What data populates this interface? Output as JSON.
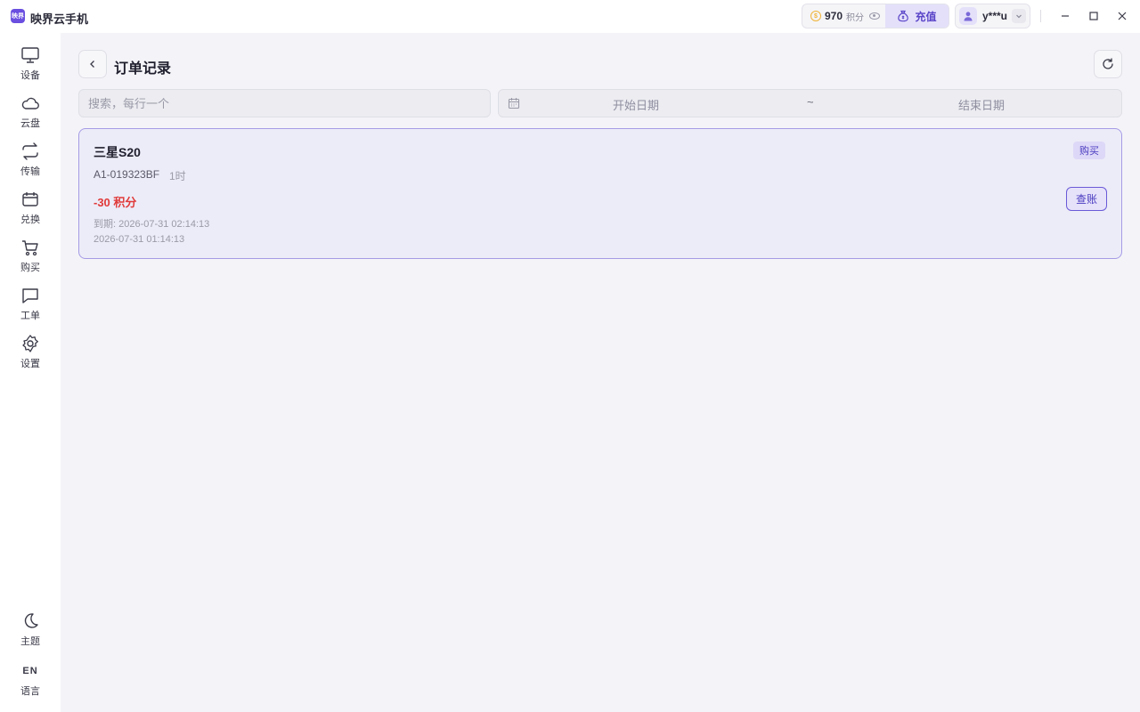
{
  "app": {
    "logo_text": "映界",
    "title": "映界云手机"
  },
  "header": {
    "points_value": "970",
    "points_unit": "积分",
    "recharge_label": "充值",
    "username": "y***u"
  },
  "sidebar": {
    "items": [
      {
        "label": "设备",
        "icon": "monitor-icon"
      },
      {
        "label": "云盘",
        "icon": "cloud-icon"
      },
      {
        "label": "传输",
        "icon": "transfer-icon"
      },
      {
        "label": "兑换",
        "icon": "ticket-icon"
      },
      {
        "label": "购买",
        "icon": "cart-icon"
      },
      {
        "label": "工单",
        "icon": "chat-icon"
      },
      {
        "label": "设置",
        "icon": "gear-icon"
      }
    ],
    "theme_label": "主题",
    "language_code": "EN",
    "language_label": "语言"
  },
  "page": {
    "title": "订单记录",
    "search_placeholder": "搜索，每行一个",
    "date_start_placeholder": "开始日期",
    "date_separator": "~",
    "date_end_placeholder": "结束日期"
  },
  "orders": [
    {
      "name": "三星S20",
      "type": "购买",
      "code": "A1-019323BF",
      "duration": "1时",
      "cost": "-30 积分",
      "expire": "到期: 2026-07-31 02:14:13",
      "time": "2026-07-31 01:14:13",
      "action_label": "查账"
    }
  ],
  "colors": {
    "accent": "#5a45c8",
    "negative": "#e03a3a",
    "card_border": "#a59be6"
  }
}
